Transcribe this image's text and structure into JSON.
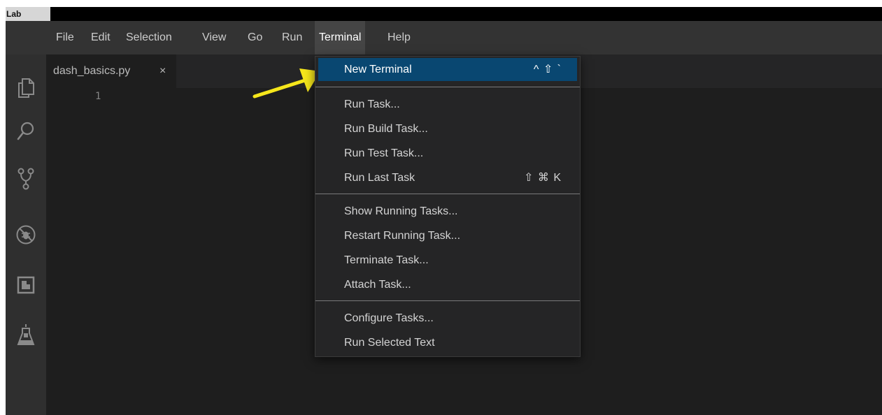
{
  "window": {
    "title": "Lab"
  },
  "menubar": {
    "items": [
      {
        "label": "File"
      },
      {
        "label": "Edit"
      },
      {
        "label": "Selection"
      },
      {
        "label": "View"
      },
      {
        "label": "Go"
      },
      {
        "label": "Run"
      },
      {
        "label": "Terminal",
        "active": true
      },
      {
        "label": "Help"
      }
    ]
  },
  "activity_bar": {
    "icons": [
      "explorer-icon",
      "search-icon",
      "source-control-icon",
      "debug-icon",
      "extensions-icon",
      "testing-flask-icon"
    ]
  },
  "editor": {
    "tab": {
      "label": "dash_basics.py",
      "close": "×"
    },
    "line_number": "1"
  },
  "terminal_menu": {
    "items": [
      {
        "label": "New Terminal",
        "shortcut": "^ ⇧ `",
        "highlighted": true
      },
      {
        "label": "Run Task..."
      },
      {
        "label": "Run Build Task..."
      },
      {
        "label": "Run Test Task..."
      },
      {
        "label": "Run Last Task",
        "shortcut": "⇧ ⌘ K"
      },
      {
        "label": "Show Running Tasks..."
      },
      {
        "label": "Restart Running Task..."
      },
      {
        "label": "Terminate Task..."
      },
      {
        "label": "Attach Task..."
      },
      {
        "label": "Configure Tasks..."
      },
      {
        "label": "Run Selected Text"
      }
    ]
  },
  "colors": {
    "highlight": "#094771",
    "annotation_arrow": "#f5e61b"
  }
}
